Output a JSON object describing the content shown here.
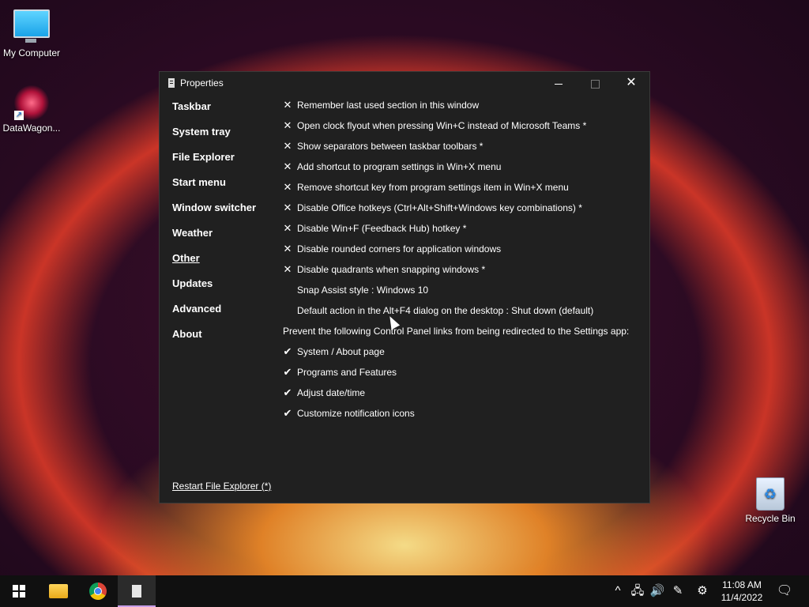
{
  "desktop": {
    "icons": [
      {
        "label": "My Computer",
        "icon": "monitor-icon"
      },
      {
        "label": "DataWagon...",
        "icon": "datawagon-icon"
      },
      {
        "label": "Recycle Bin",
        "icon": "recycle-bin-icon"
      }
    ]
  },
  "window": {
    "title": "Properties",
    "controls": {
      "minimize": "minimize-icon",
      "maximize": "maximize-icon",
      "close": "close-icon"
    }
  },
  "nav": {
    "items": [
      {
        "label": "Taskbar"
      },
      {
        "label": "System tray"
      },
      {
        "label": "File Explorer"
      },
      {
        "label": "Start menu"
      },
      {
        "label": "Window switcher"
      },
      {
        "label": "Weather"
      },
      {
        "label": "Other",
        "active": true
      },
      {
        "label": "Updates"
      },
      {
        "label": "Advanced"
      },
      {
        "label": "About"
      }
    ]
  },
  "options": {
    "rows": [
      {
        "mark": "✕",
        "text": "Remember last used section in this window"
      },
      {
        "mark": "✕",
        "text": "Open clock flyout when pressing Win+C instead of Microsoft Teams *"
      },
      {
        "mark": "✕",
        "text": "Show separators between taskbar toolbars *"
      },
      {
        "mark": "✕",
        "text": "Add shortcut to program settings in Win+X menu"
      },
      {
        "mark": "✕",
        "text": "Remove shortcut key from program settings item in Win+X menu"
      },
      {
        "mark": "✕",
        "text": "Disable Office hotkeys (Ctrl+Alt+Shift+Windows key combinations) *"
      },
      {
        "mark": "✕",
        "text": "Disable Win+F (Feedback Hub) hotkey *"
      },
      {
        "mark": "✕",
        "text": "Disable rounded corners for application windows"
      },
      {
        "mark": "✕",
        "text": "Disable quadrants when snapping windows *"
      },
      {
        "mark": "",
        "text": "Snap Assist style : Windows 10"
      },
      {
        "mark": "",
        "text": "Default action in the Alt+F4 dialog on the desktop : Shut down (default)"
      }
    ],
    "section_header": "Prevent the following Control Panel links from being redirected to the Settings app:",
    "checked_rows": [
      {
        "mark": "✔",
        "text": "System / About page"
      },
      {
        "mark": "✔",
        "text": "Programs and Features"
      },
      {
        "mark": "✔",
        "text": "Adjust date/time"
      },
      {
        "mark": "✔",
        "text": "Customize notification icons"
      }
    ]
  },
  "footer": {
    "restart_link": "Restart File Explorer (*)"
  },
  "taskbar": {
    "apps": [
      "start-icon",
      "file-explorer-icon",
      "chrome-icon",
      "properties-app-icon"
    ],
    "tray": {
      "chevron": "^",
      "network": "🖧",
      "volume": "🔊",
      "pen": "✎",
      "settings": "⚙"
    },
    "clock": {
      "time": "11:08 AM",
      "date": "11/4/2022"
    },
    "notification": "🗨"
  }
}
